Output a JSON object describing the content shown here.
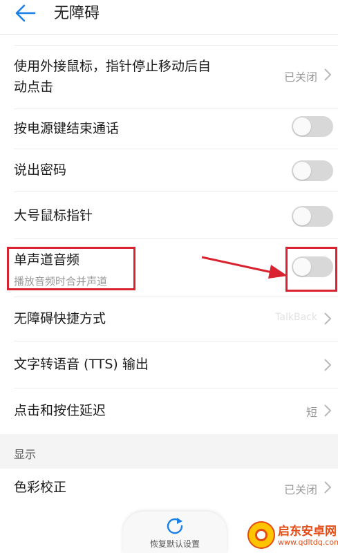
{
  "header": {
    "title": "无障碍",
    "back_icon": "arrow-left-icon",
    "accent": "#1a7fe6"
  },
  "items": [
    {
      "label_line1": "使用外接鼠标，指针停止移动后自",
      "label_line2": "动点击",
      "value": "已关闭"
    },
    {
      "label": "按电源键结束通话",
      "checked": false
    },
    {
      "label": "说出密码",
      "checked": false
    },
    {
      "label": "大号鼠标指针",
      "checked": false
    },
    {
      "label": "单声道音频",
      "sublabel": "播放音频时合并声道",
      "checked": false
    },
    {
      "label": "无障碍快捷方式",
      "value": "TalkBack"
    },
    {
      "label": "文字转语音 (TTS) 输出"
    },
    {
      "label": "点击和按住延迟",
      "value": "短"
    }
  ],
  "section": {
    "label": "显示"
  },
  "display_items": [
    {
      "label": "色彩校正",
      "value": "已关闭"
    }
  ],
  "footer": {
    "restore_label": "恢复默认设置",
    "icon": "refresh-icon"
  },
  "annotation": {
    "color": "#d9222f"
  },
  "watermark": {
    "name": "启东安卓网",
    "url": "www.qdltdq.com"
  }
}
